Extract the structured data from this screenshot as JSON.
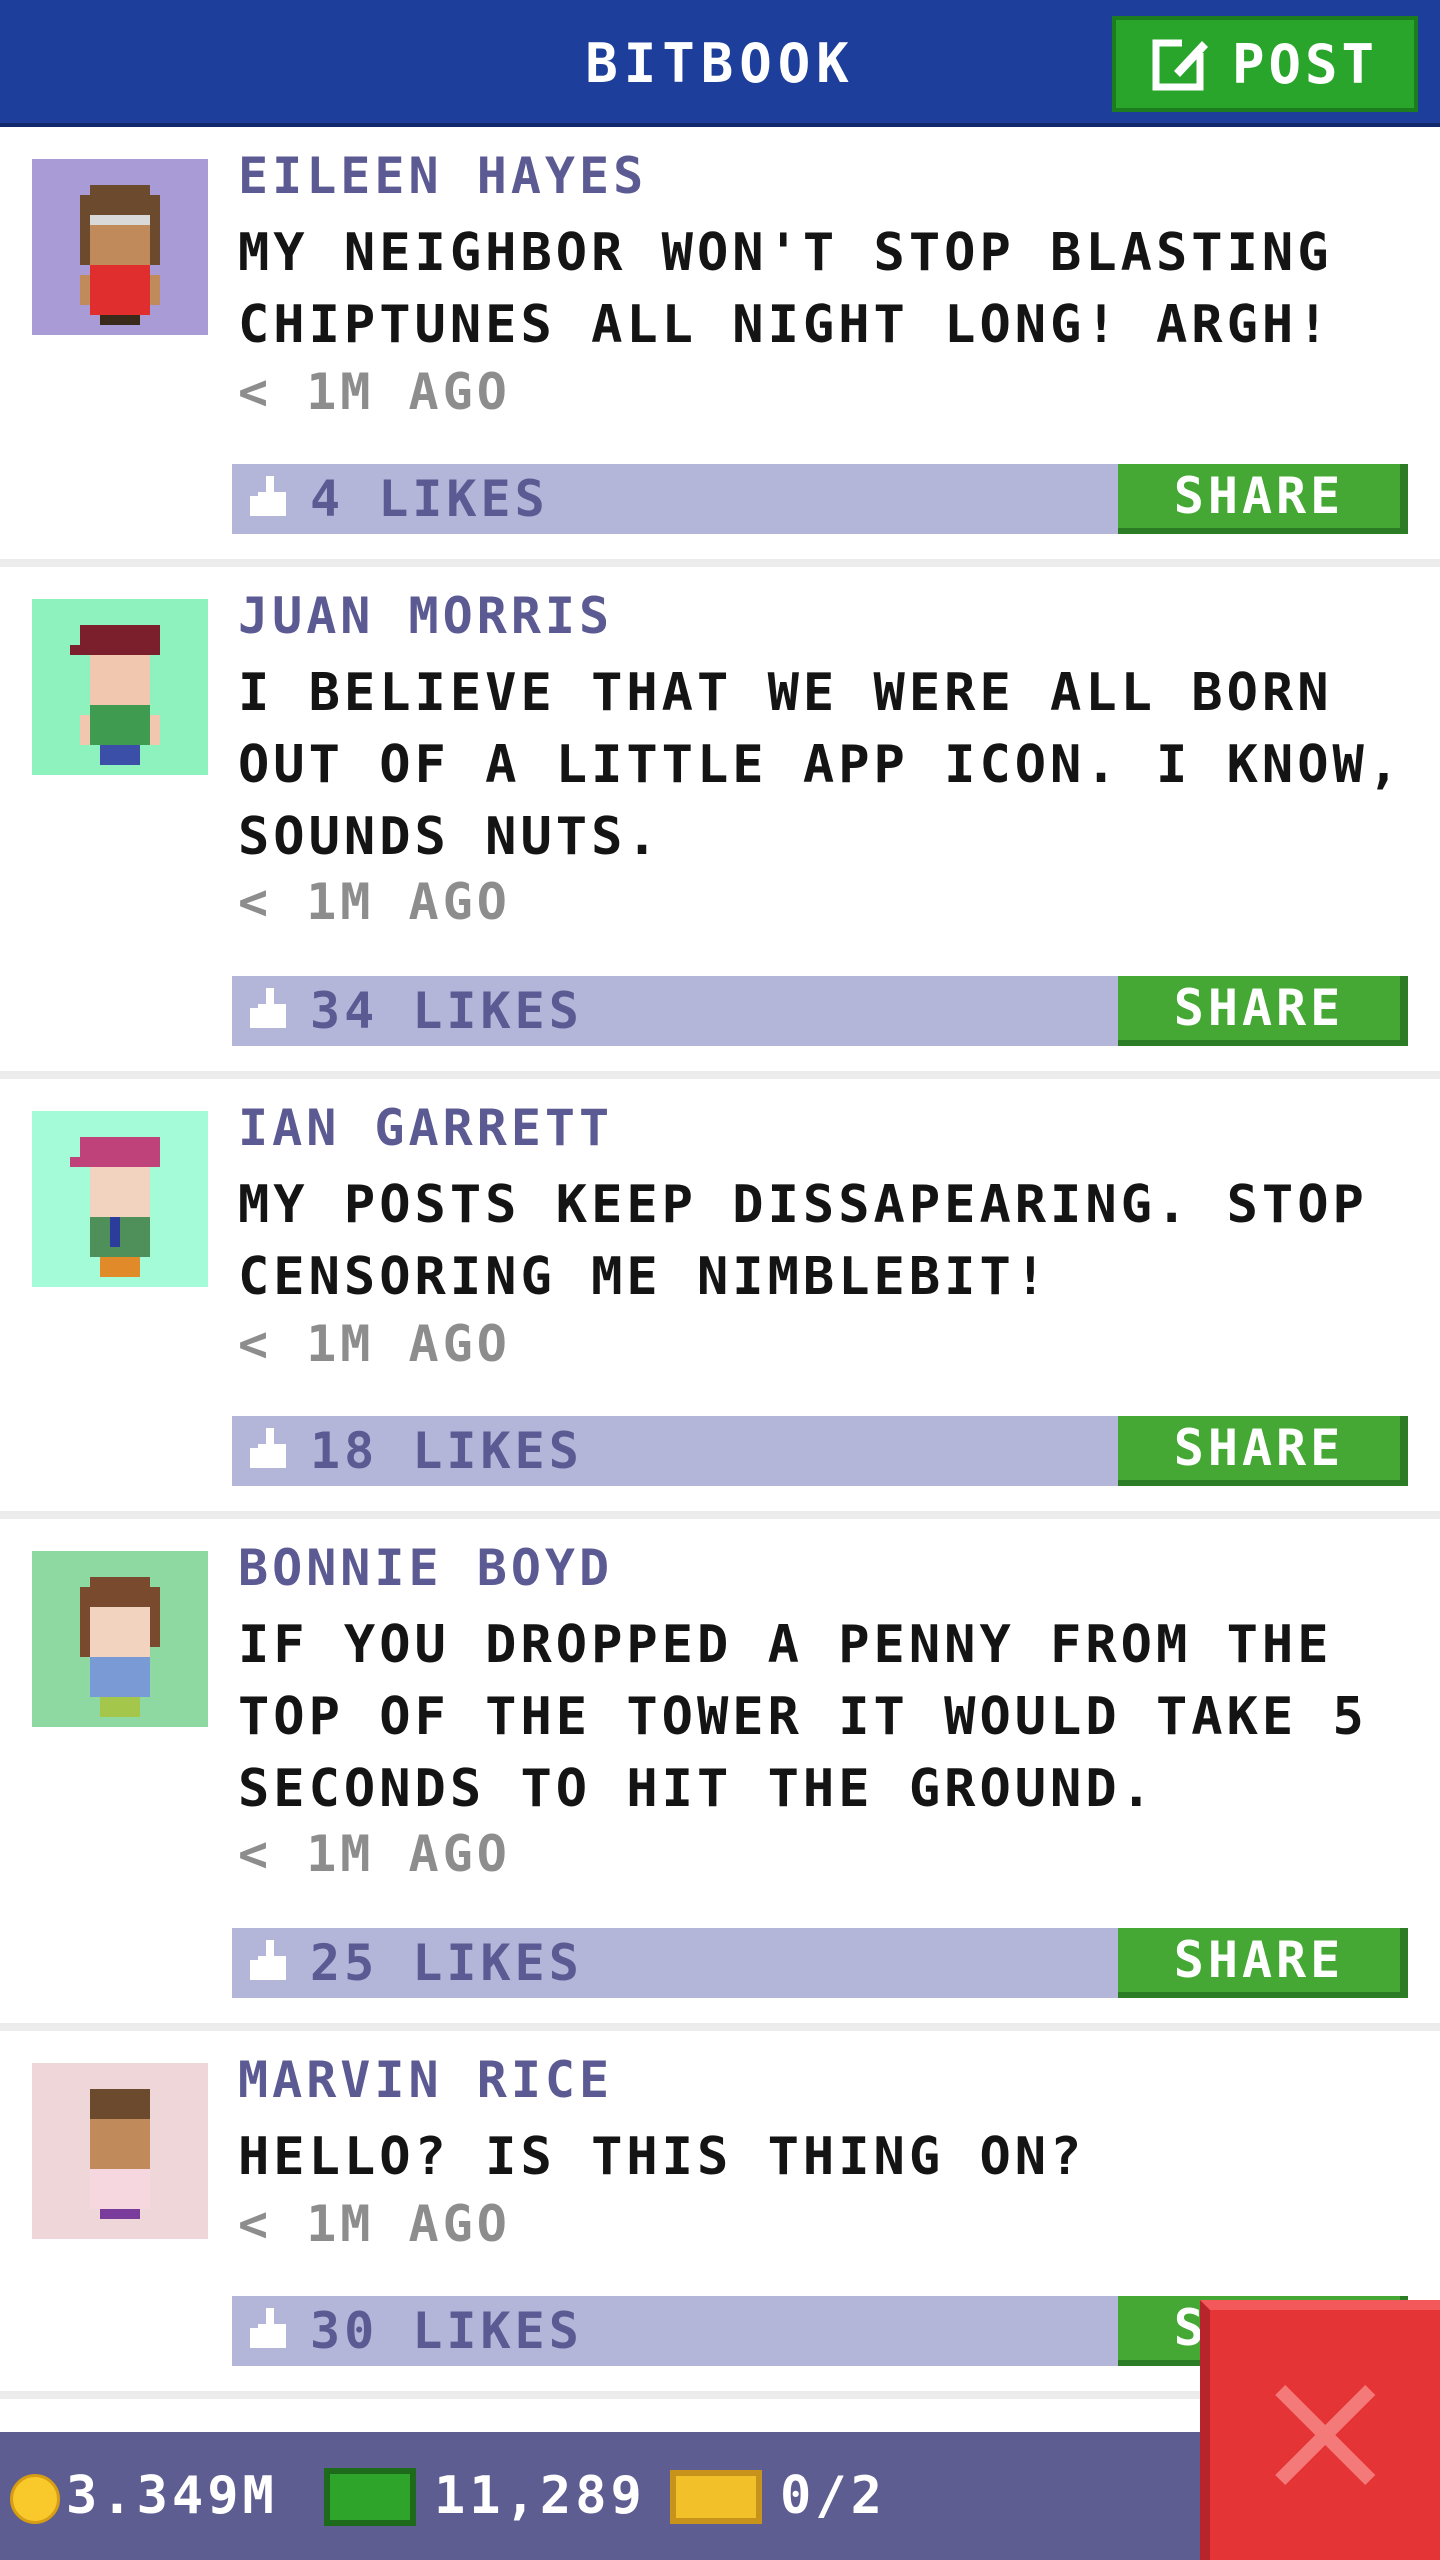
{
  "header": {
    "title": "BITBOOK",
    "post_label": "POST",
    "post_icon": "compose-icon"
  },
  "posts": [
    {
      "name": "EILEEN HAYES",
      "message": "MY NEIGHBOR WON'T STOP BLASTING CHIPTUNES ALL NIGHT LONG! ARGH!",
      "time": "< 1M AGO",
      "likes": "4 LIKES",
      "share": "SHARE",
      "avatar_bg": "#a89bd6"
    },
    {
      "name": "JUAN MORRIS",
      "message": "I BELIEVE THAT WE WERE ALL BORN OUT OF A LITTLE APP ICON. I KNOW, SOUNDS NUTS.",
      "time": "< 1M AGO",
      "likes": "34 LIKES",
      "share": "SHARE",
      "avatar_bg": "#8ef2bf"
    },
    {
      "name": "IAN GARRETT",
      "message": "MY POSTS KEEP DISSAPEARING. STOP CENSORING ME NIMBLEBIT!",
      "time": "< 1M AGO",
      "likes": "18 LIKES",
      "share": "SHARE",
      "avatar_bg": "#a3fbd8"
    },
    {
      "name": "BONNIE BOYD",
      "message": "IF YOU DROPPED A PENNY FROM THE TOP OF THE TOWER IT WOULD TAKE 5 SECONDS TO HIT THE GROUND.",
      "time": "< 1M AGO",
      "likes": "25 LIKES",
      "share": "SHARE",
      "avatar_bg": "#8ed8a2"
    },
    {
      "name": "MARVIN RICE",
      "message": "HELLO? IS THIS THING ON?",
      "time": "< 1M AGO",
      "likes": "30 LIKES",
      "share": "SHARE",
      "avatar_bg": "#efd6d9"
    }
  ],
  "footer": {
    "coins": "3.349M",
    "bux": "11,289",
    "tickets": "0/2",
    "coin_icon": "coin-icon",
    "bux_icon": "bux-icon",
    "ticket_icon": "ticket-icon"
  },
  "close_icon": "close-icon",
  "colors": {
    "header": "#1d3f9b",
    "accent_green": "#45a834",
    "like_bar": "#b3b6d9",
    "name": "#5c5a92",
    "close": "#e43436"
  }
}
